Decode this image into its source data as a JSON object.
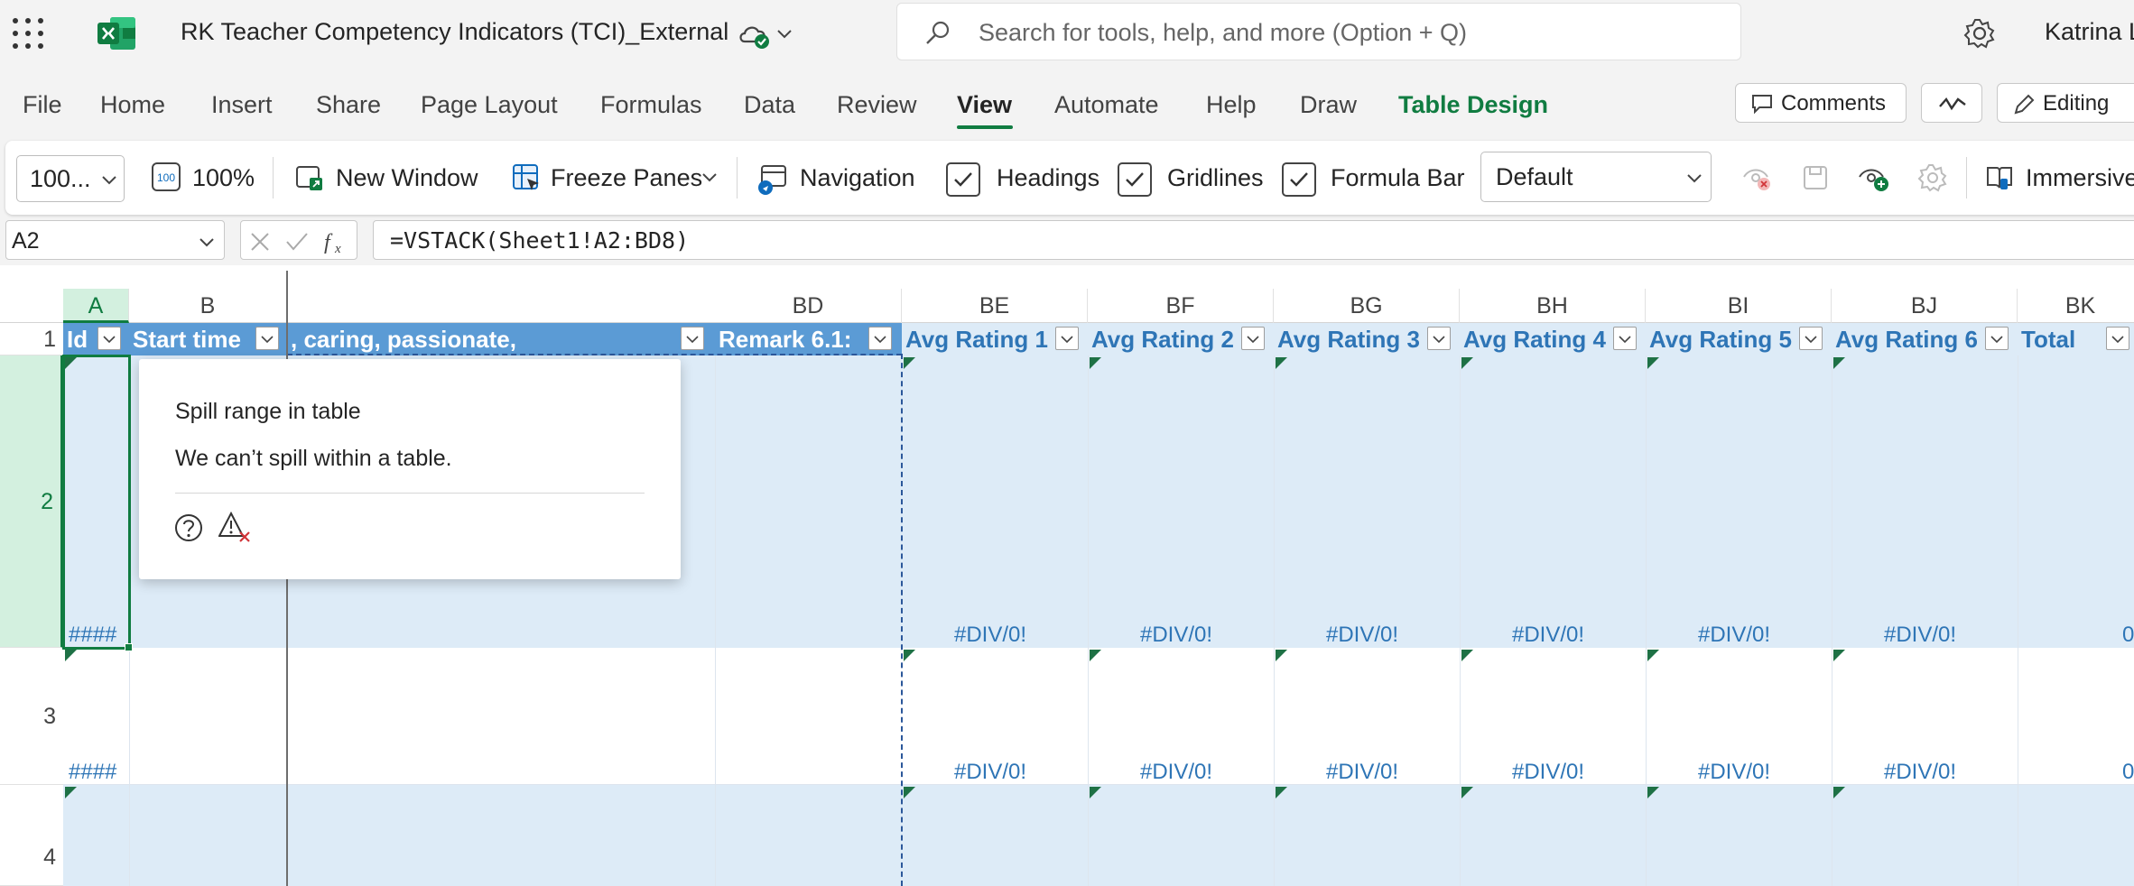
{
  "titlebar": {
    "doc_title": "RK Teacher Competency Indicators (TCI)_External",
    "search_placeholder": "Search for tools, help, and more (Option + Q)",
    "user_name": "Katrina L"
  },
  "menu": {
    "items": [
      "File",
      "Home",
      "Insert",
      "Share",
      "Page Layout",
      "Formulas",
      "Data",
      "Review",
      "View",
      "Automate",
      "Help",
      "Draw",
      "Table Design"
    ],
    "active": "View",
    "comments_label": "Comments",
    "editing_label": "Editing"
  },
  "ribbon": {
    "zoom_value": "100...",
    "zoom100_label": "100%",
    "new_window_label": "New Window",
    "freeze_panes_label": "Freeze Panes",
    "navigation_label": "Navigation",
    "headings_label": "Headings",
    "gridlines_label": "Gridlines",
    "formula_bar_label": "Formula Bar",
    "sheet_view_value": "Default",
    "immersive_label": "Immersive"
  },
  "formula_bar": {
    "name_box": "A2",
    "formula": "=VSTACK(Sheet1!A2:BD8)"
  },
  "grid": {
    "columns": [
      "A",
      "B",
      "BD",
      "BE",
      "BF",
      "BG",
      "BH",
      "BI",
      "BJ",
      "BK"
    ],
    "selected_column": "A",
    "rows": [
      "1",
      "2",
      "3",
      "4"
    ],
    "selected_row": "2",
    "headers": {
      "a": "Id",
      "b": "Start time",
      "mid": ", caring, passionate,",
      "bd": "Remark 6.1:",
      "be": "Avg Rating 1",
      "bf": "Avg Rating 2",
      "bg": "Avg Rating 3",
      "bh": "Avg Rating 4",
      "bi": "Avg Rating 5",
      "bj": "Avg Rating 6",
      "bk": "Total"
    },
    "hash_value": "####",
    "error_value": "#DIV/0!",
    "total_value": "0"
  },
  "popup": {
    "title": "Spill range in table",
    "message": "We can’t spill within a table."
  },
  "colors": {
    "excel_green": "#107c41",
    "table_header_blue": "#5b9bd5",
    "table_band": "#ddebf7",
    "error_text": "#2e75b6"
  }
}
